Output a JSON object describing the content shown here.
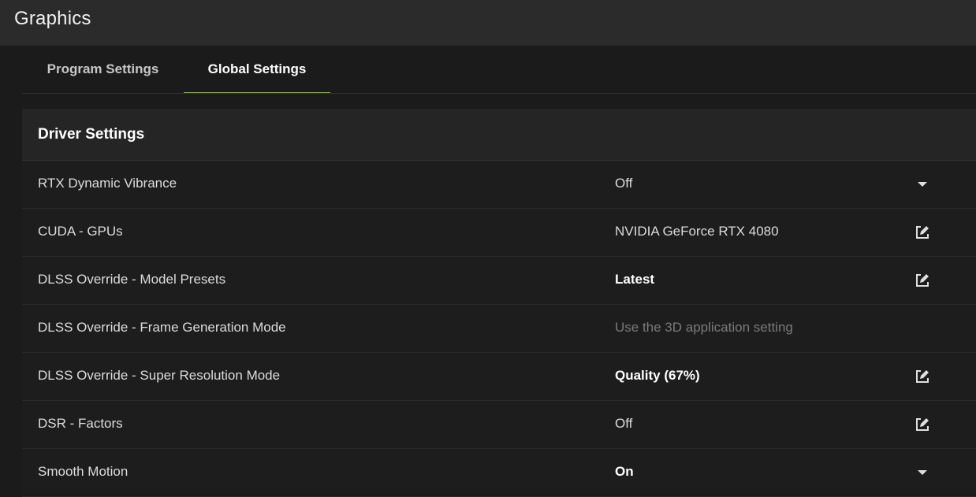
{
  "header": {
    "title": "Graphics"
  },
  "tabs": [
    {
      "label": "Program Settings",
      "active": false
    },
    {
      "label": "Global Settings",
      "active": true
    }
  ],
  "accent_color": "#76b900",
  "section": {
    "title": "Driver Settings",
    "rows": [
      {
        "label": "RTX Dynamic Vibrance",
        "value": "Off",
        "style": "normal",
        "action": "chevron-down-icon"
      },
      {
        "label": "CUDA - GPUs",
        "value": "NVIDIA GeForce RTX 4080",
        "style": "normal",
        "action": "edit-icon"
      },
      {
        "label": "DLSS Override - Model Presets",
        "value": "Latest",
        "style": "bold",
        "action": "edit-icon"
      },
      {
        "label": "DLSS Override - Frame Generation Mode",
        "value": "Use the 3D application setting",
        "style": "disabled",
        "action": "none"
      },
      {
        "label": "DLSS Override - Super Resolution Mode",
        "value": "Quality (67%)",
        "style": "bold",
        "action": "edit-icon"
      },
      {
        "label": "DSR - Factors",
        "value": "Off",
        "style": "normal",
        "action": "edit-icon"
      },
      {
        "label": "Smooth Motion",
        "value": "On",
        "style": "bold",
        "action": "chevron-down-icon"
      }
    ]
  }
}
